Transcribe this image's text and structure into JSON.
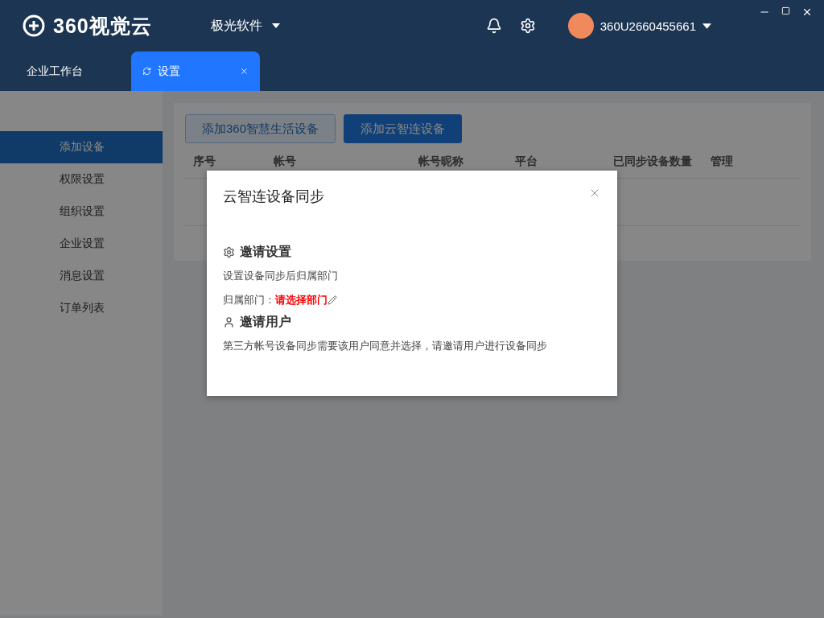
{
  "app": {
    "logo_text": "360视觉云",
    "org": "极光软件",
    "user": "360U2660455661"
  },
  "tabs": [
    {
      "label": "企业工作台",
      "selected": false
    },
    {
      "label": "设置",
      "selected": true
    }
  ],
  "sidebar": {
    "items": [
      {
        "label": "添加设备",
        "selected": true
      },
      {
        "label": "权限设置",
        "selected": false
      },
      {
        "label": "组织设置",
        "selected": false
      },
      {
        "label": "企业设置",
        "selected": false
      },
      {
        "label": "消息设置",
        "selected": false
      },
      {
        "label": "订单列表",
        "selected": false
      }
    ]
  },
  "buttons": [
    {
      "label": "添加360智慧生活设备",
      "kind": "outline"
    },
    {
      "label": "添加云智连设备",
      "kind": "primary"
    }
  ],
  "table": {
    "columns": [
      "序号",
      "帐号",
      "帐号昵称",
      "平台",
      "已同步设备数量",
      "管理"
    ]
  },
  "dialog": {
    "title": "云智连设备同步",
    "sections": [
      {
        "kind": "settings",
        "heading": "邀请设置",
        "description": "设置设备同步后归属部门",
        "field": {
          "label": "归属部门：",
          "value": "请选择部门"
        }
      },
      {
        "kind": "user",
        "heading": "邀请用户",
        "description": "第三方帐号设备同步需要该用户同意并选择，请邀请用户进行设备同步"
      }
    ]
  }
}
